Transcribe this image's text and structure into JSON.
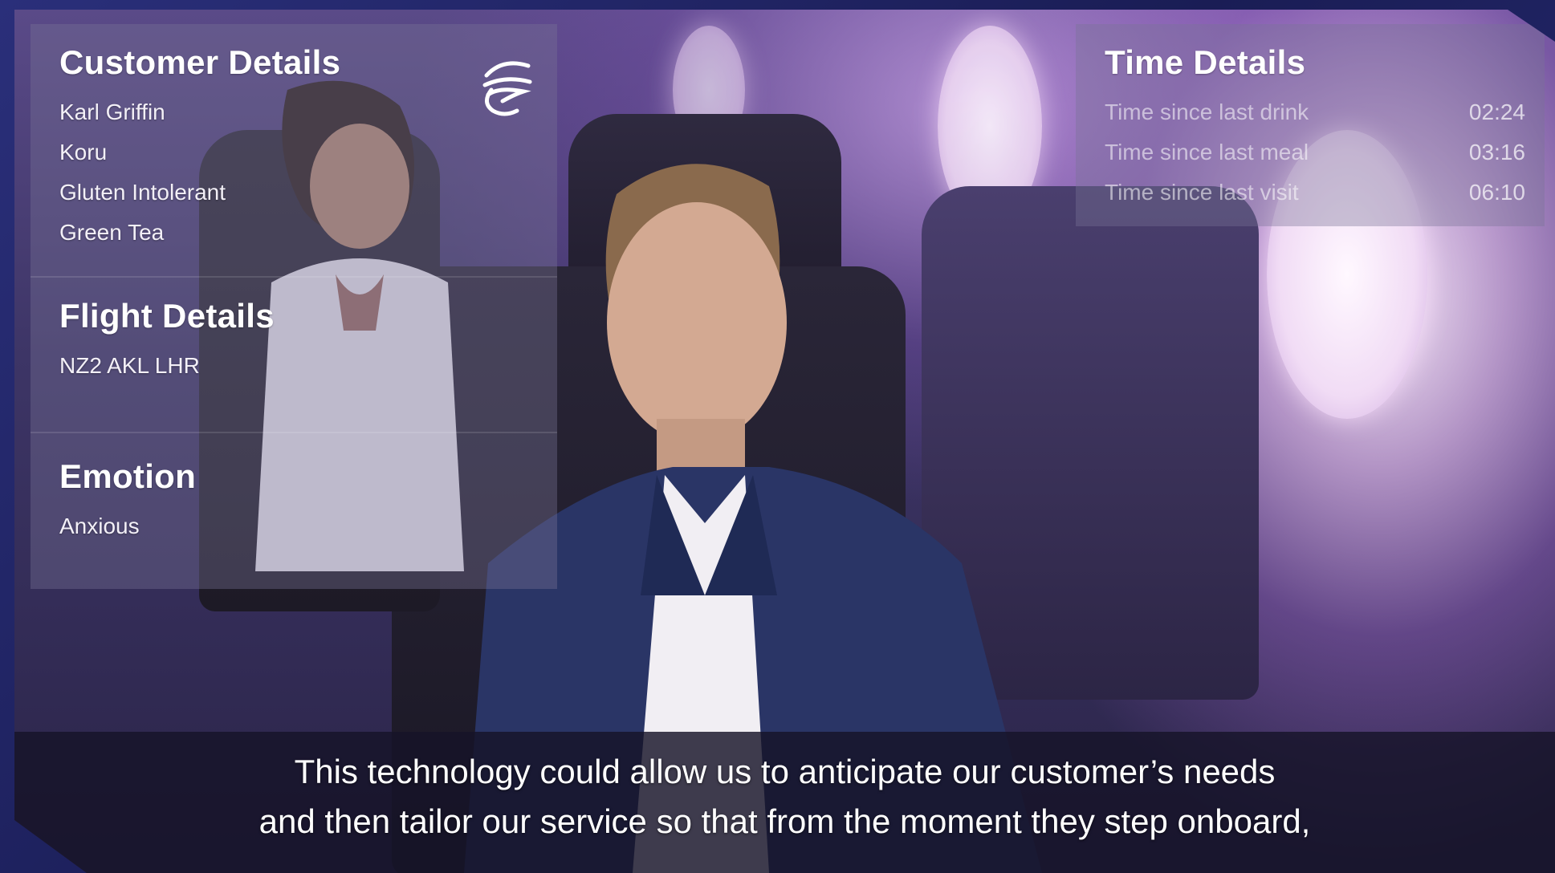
{
  "customer_details": {
    "heading": "Customer Details",
    "items": [
      "Karl Griffin",
      "Koru",
      "Gluten Intolerant",
      "Green Tea"
    ]
  },
  "flight_details": {
    "heading": "Flight Details",
    "items": [
      "NZ2 AKL LHR"
    ]
  },
  "emotion": {
    "heading": "Emotion",
    "value": "Anxious"
  },
  "time_details": {
    "heading": "Time Details",
    "rows": [
      {
        "label": "Time since last drink",
        "value": "02:24"
      },
      {
        "label": "Time since last meal",
        "value": "03:16"
      },
      {
        "label": "Time since last visit",
        "value": "06:10"
      }
    ]
  },
  "caption": {
    "line1": "This technology could allow us to anticipate our customer’s needs",
    "line2": "and then tailor our service so that from the moment they step onboard,"
  },
  "colors": {
    "cabin_purple": "#7a5aa8",
    "panel_overlay": "#78738f",
    "caption_bg": "#161428"
  },
  "icons": {
    "airline_logo": "koru-logo-icon"
  }
}
